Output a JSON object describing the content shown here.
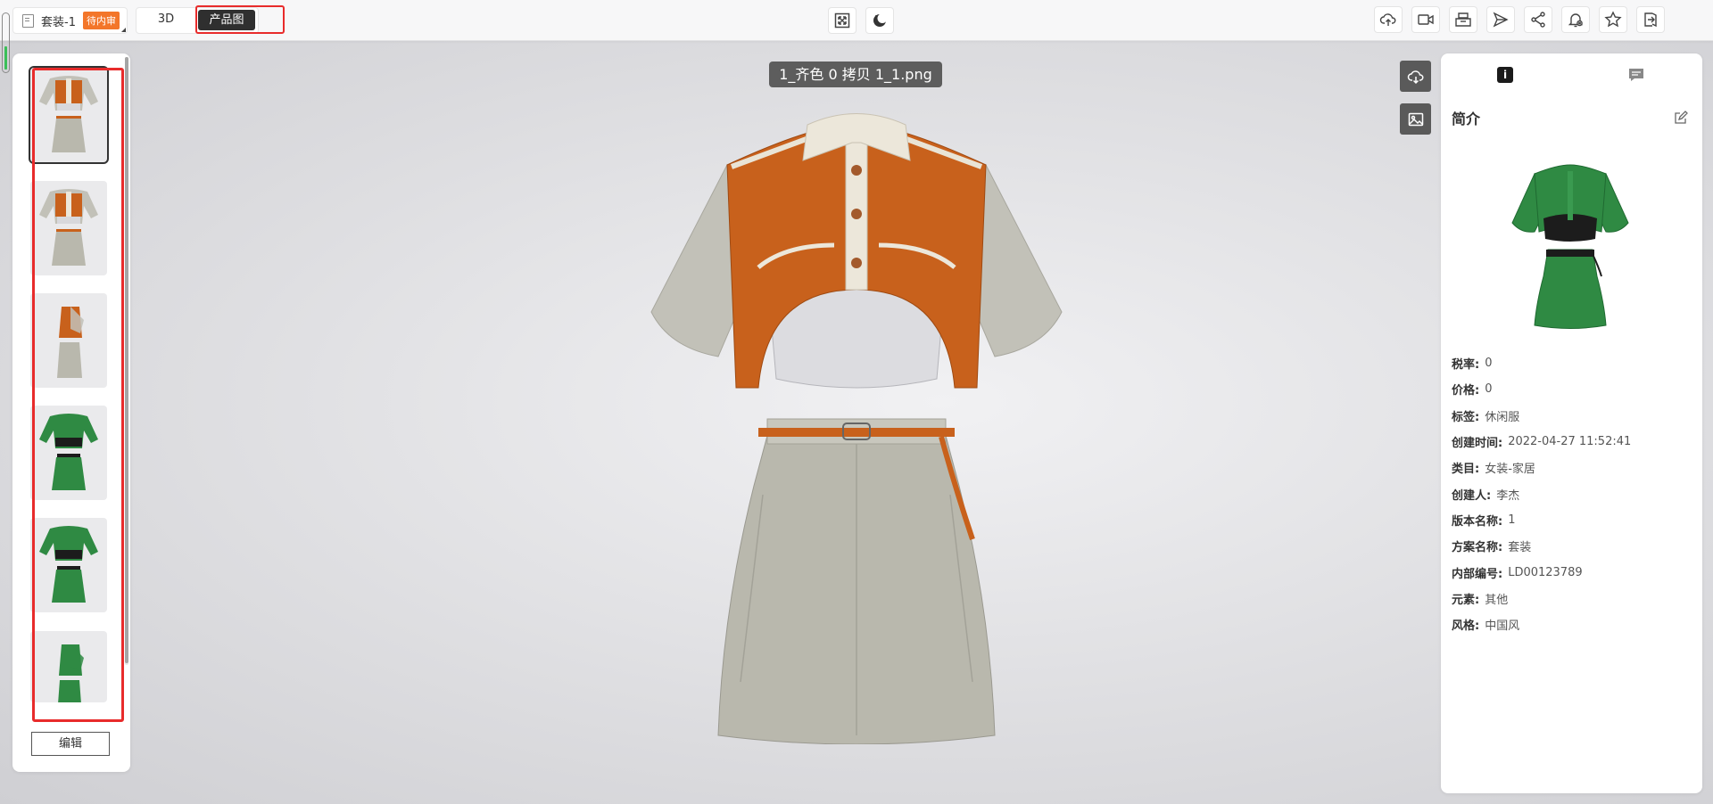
{
  "topbar": {
    "doc_name": "套装-1",
    "status_badge": "待内审",
    "mode_3d": "3D",
    "mode_product": "产品图",
    "center_tools": [
      "fullscreen-icon",
      "night-mode-icon"
    ],
    "right_tools": [
      "cloud-upload-icon",
      "video-icon",
      "archive-icon",
      "send-icon",
      "share-icon",
      "notification-icon",
      "star-icon",
      "exit-icon"
    ]
  },
  "thumbnails": [
    {
      "colorway": "orange",
      "view": "front",
      "selected": true
    },
    {
      "colorway": "orange",
      "view": "back",
      "selected": false
    },
    {
      "colorway": "orange",
      "view": "side",
      "selected": false
    },
    {
      "colorway": "green",
      "view": "front",
      "selected": false
    },
    {
      "colorway": "green",
      "view": "back",
      "selected": false
    },
    {
      "colorway": "green",
      "view": "side",
      "selected": false
    }
  ],
  "edit_button": "编辑",
  "viewer": {
    "file_label": "1_齐色 0 拷贝 1_1.png",
    "side_tools": [
      "cloud-download-icon",
      "image-icon"
    ]
  },
  "info": {
    "tab_info": "i",
    "title": "简介",
    "fields": [
      {
        "label": "税率:",
        "value": "0"
      },
      {
        "label": "价格:",
        "value": "0"
      },
      {
        "label": "标签:",
        "value": "休闲服"
      },
      {
        "label": "创建时间:",
        "value": "2022-04-27 11:52:41"
      },
      {
        "label": "类目:",
        "value": "女装-家居"
      },
      {
        "label": "创建人:",
        "value": "李杰"
      },
      {
        "label": "版本名称:",
        "value": "1"
      },
      {
        "label": "方案名称:",
        "value": "套装"
      },
      {
        "label": "内部编号:",
        "value": "LD00123789"
      },
      {
        "label": "元素:",
        "value": "其他"
      },
      {
        "label": "风格:",
        "value": "中国风"
      }
    ]
  },
  "colors": {
    "accent_orange": "#c8611c",
    "garment_grey": "#b9b8ad",
    "garment_green": "#2f8a43",
    "highlight_red": "#e82b2b",
    "badge_orange": "#f3762a"
  }
}
